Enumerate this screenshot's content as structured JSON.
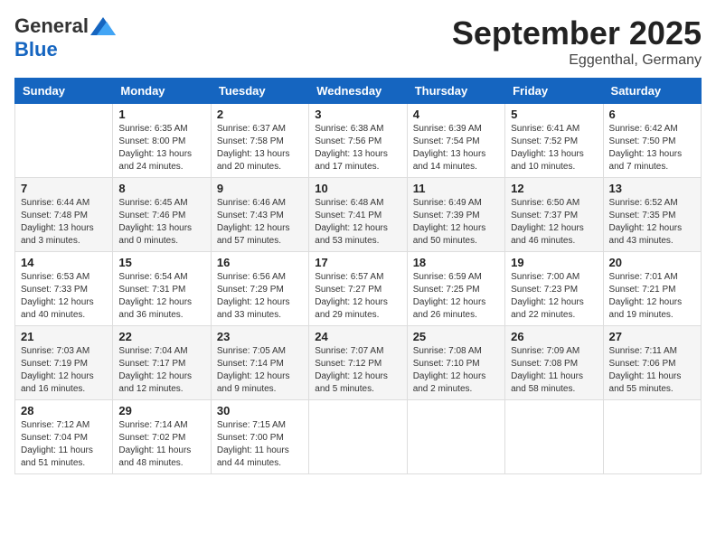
{
  "header": {
    "logo_general": "General",
    "logo_blue": "Blue",
    "month": "September 2025",
    "location": "Eggenthal, Germany"
  },
  "weekdays": [
    "Sunday",
    "Monday",
    "Tuesday",
    "Wednesday",
    "Thursday",
    "Friday",
    "Saturday"
  ],
  "weeks": [
    [
      {
        "day": "",
        "info": ""
      },
      {
        "day": "1",
        "info": "Sunrise: 6:35 AM\nSunset: 8:00 PM\nDaylight: 13 hours\nand 24 minutes."
      },
      {
        "day": "2",
        "info": "Sunrise: 6:37 AM\nSunset: 7:58 PM\nDaylight: 13 hours\nand 20 minutes."
      },
      {
        "day": "3",
        "info": "Sunrise: 6:38 AM\nSunset: 7:56 PM\nDaylight: 13 hours\nand 17 minutes."
      },
      {
        "day": "4",
        "info": "Sunrise: 6:39 AM\nSunset: 7:54 PM\nDaylight: 13 hours\nand 14 minutes."
      },
      {
        "day": "5",
        "info": "Sunrise: 6:41 AM\nSunset: 7:52 PM\nDaylight: 13 hours\nand 10 minutes."
      },
      {
        "day": "6",
        "info": "Sunrise: 6:42 AM\nSunset: 7:50 PM\nDaylight: 13 hours\nand 7 minutes."
      }
    ],
    [
      {
        "day": "7",
        "info": "Sunrise: 6:44 AM\nSunset: 7:48 PM\nDaylight: 13 hours\nand 3 minutes."
      },
      {
        "day": "8",
        "info": "Sunrise: 6:45 AM\nSunset: 7:46 PM\nDaylight: 13 hours\nand 0 minutes."
      },
      {
        "day": "9",
        "info": "Sunrise: 6:46 AM\nSunset: 7:43 PM\nDaylight: 12 hours\nand 57 minutes."
      },
      {
        "day": "10",
        "info": "Sunrise: 6:48 AM\nSunset: 7:41 PM\nDaylight: 12 hours\nand 53 minutes."
      },
      {
        "day": "11",
        "info": "Sunrise: 6:49 AM\nSunset: 7:39 PM\nDaylight: 12 hours\nand 50 minutes."
      },
      {
        "day": "12",
        "info": "Sunrise: 6:50 AM\nSunset: 7:37 PM\nDaylight: 12 hours\nand 46 minutes."
      },
      {
        "day": "13",
        "info": "Sunrise: 6:52 AM\nSunset: 7:35 PM\nDaylight: 12 hours\nand 43 minutes."
      }
    ],
    [
      {
        "day": "14",
        "info": "Sunrise: 6:53 AM\nSunset: 7:33 PM\nDaylight: 12 hours\nand 40 minutes."
      },
      {
        "day": "15",
        "info": "Sunrise: 6:54 AM\nSunset: 7:31 PM\nDaylight: 12 hours\nand 36 minutes."
      },
      {
        "day": "16",
        "info": "Sunrise: 6:56 AM\nSunset: 7:29 PM\nDaylight: 12 hours\nand 33 minutes."
      },
      {
        "day": "17",
        "info": "Sunrise: 6:57 AM\nSunset: 7:27 PM\nDaylight: 12 hours\nand 29 minutes."
      },
      {
        "day": "18",
        "info": "Sunrise: 6:59 AM\nSunset: 7:25 PM\nDaylight: 12 hours\nand 26 minutes."
      },
      {
        "day": "19",
        "info": "Sunrise: 7:00 AM\nSunset: 7:23 PM\nDaylight: 12 hours\nand 22 minutes."
      },
      {
        "day": "20",
        "info": "Sunrise: 7:01 AM\nSunset: 7:21 PM\nDaylight: 12 hours\nand 19 minutes."
      }
    ],
    [
      {
        "day": "21",
        "info": "Sunrise: 7:03 AM\nSunset: 7:19 PM\nDaylight: 12 hours\nand 16 minutes."
      },
      {
        "day": "22",
        "info": "Sunrise: 7:04 AM\nSunset: 7:17 PM\nDaylight: 12 hours\nand 12 minutes."
      },
      {
        "day": "23",
        "info": "Sunrise: 7:05 AM\nSunset: 7:14 PM\nDaylight: 12 hours\nand 9 minutes."
      },
      {
        "day": "24",
        "info": "Sunrise: 7:07 AM\nSunset: 7:12 PM\nDaylight: 12 hours\nand 5 minutes."
      },
      {
        "day": "25",
        "info": "Sunrise: 7:08 AM\nSunset: 7:10 PM\nDaylight: 12 hours\nand 2 minutes."
      },
      {
        "day": "26",
        "info": "Sunrise: 7:09 AM\nSunset: 7:08 PM\nDaylight: 11 hours\nand 58 minutes."
      },
      {
        "day": "27",
        "info": "Sunrise: 7:11 AM\nSunset: 7:06 PM\nDaylight: 11 hours\nand 55 minutes."
      }
    ],
    [
      {
        "day": "28",
        "info": "Sunrise: 7:12 AM\nSunset: 7:04 PM\nDaylight: 11 hours\nand 51 minutes."
      },
      {
        "day": "29",
        "info": "Sunrise: 7:14 AM\nSunset: 7:02 PM\nDaylight: 11 hours\nand 48 minutes."
      },
      {
        "day": "30",
        "info": "Sunrise: 7:15 AM\nSunset: 7:00 PM\nDaylight: 11 hours\nand 44 minutes."
      },
      {
        "day": "",
        "info": ""
      },
      {
        "day": "",
        "info": ""
      },
      {
        "day": "",
        "info": ""
      },
      {
        "day": "",
        "info": ""
      }
    ]
  ]
}
